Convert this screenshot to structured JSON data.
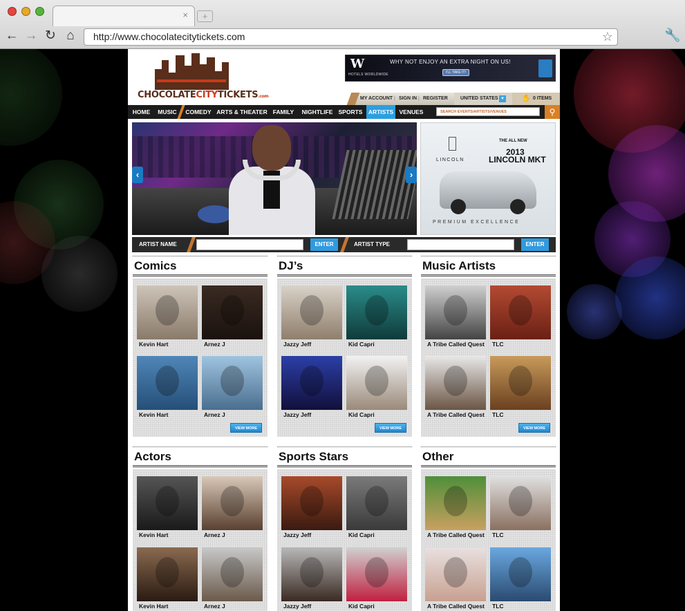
{
  "browser": {
    "url": "http://www.chocolatecitytickets.com",
    "new_tab_label": "+",
    "close_tab": "×"
  },
  "logo": {
    "part1": "CHOCOLATE",
    "part2": "CITY",
    "part3": "TICKETS",
    "suffix": ".com"
  },
  "top_ad": {
    "brand": "W",
    "sub": "HOTELS WORLDWIDE",
    "message": "WHY NOT ENJOY AN EXTRA NIGHT ON US!",
    "button": "I'LL TAKE IT!"
  },
  "util": {
    "my_account": "MY ACCOUNT",
    "sign_in": "SIGN IN",
    "register": "REGISTER",
    "country": "UNITED STATES",
    "cart": "0 ITEMS"
  },
  "nav": {
    "items": [
      {
        "label": "HOME"
      },
      {
        "label": "MUSIC"
      },
      {
        "label": "COMEDY"
      },
      {
        "label": "ARTS & THEATER"
      },
      {
        "label": "FAMILY"
      },
      {
        "label": "NIGHTLIFE"
      },
      {
        "label": "SPORTS"
      },
      {
        "label": "ARTISTS"
      },
      {
        "label": "VENUES"
      }
    ],
    "active": "ARTISTS",
    "search_placeholder": "SEARCH EVENTS/ARTISTS/VENUES"
  },
  "side_ad": {
    "brand": "LINCOLN",
    "headline": "THE ALL NEW",
    "year": "2013",
    "model": "LINCOLN MKT",
    "tagline": "PREMIUM EXCELLENCE"
  },
  "artist_search": {
    "name_label": "ARTIST NAME",
    "type_label": "ARTIST TYPE",
    "enter": "ENTER"
  },
  "sections": [
    {
      "title": "Comics",
      "cards": [
        "Kevin Hart",
        "Arnez J",
        "Kevin Hart",
        "Arnez J"
      ],
      "view_more": "VIEW MORE"
    },
    {
      "title": "DJ’s",
      "cards": [
        "Jazzy Jeff",
        "Kid Capri",
        "Jazzy Jeff",
        "Kid Capri"
      ],
      "view_more": "VIEW MORE"
    },
    {
      "title": "Music Artists",
      "cards": [
        "A Tribe Called Quest",
        "TLC",
        "A Tribe Called Quest",
        "TLC"
      ],
      "view_more": "VIEW MORE"
    },
    {
      "title": "Actors",
      "cards": [
        "Kevin Hart",
        "Arnez J",
        "Kevin Hart",
        "Arnez J"
      ]
    },
    {
      "title": "Sports Stars",
      "cards": [
        "Jazzy Jeff",
        "Kid Capri",
        "Jazzy Jeff",
        "Kid Capri"
      ]
    },
    {
      "title": "Other",
      "cards": [
        "A Tribe Called Quest",
        "TLC",
        "A Tribe Called Quest",
        "TLC"
      ]
    }
  ],
  "colors": {
    "accent_blue": "#2b9fe0",
    "accent_orange": "#d98025",
    "brand_brown": "#5a2e1a",
    "brand_red": "#c63b1b"
  }
}
